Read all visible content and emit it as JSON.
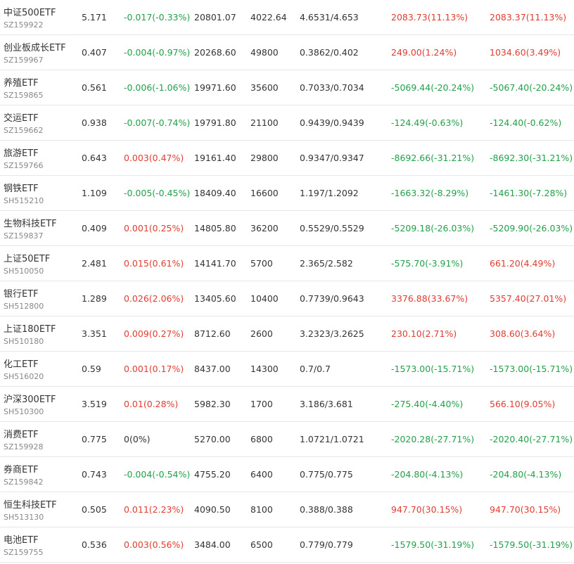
{
  "colors": {
    "up": "#e03c31",
    "down": "#21a04a",
    "flat": "#333333"
  },
  "rows": [
    {
      "name": "中证500ETF",
      "code": "SZ159922",
      "price": "5.171",
      "change": "-0.017(-0.33%)",
      "change_dir": "down",
      "amount": "20801.07",
      "volume": "4022.64",
      "range": "4.6531/4.653",
      "p1": "2083.73(11.13%)",
      "p1_dir": "up",
      "p2": "2083.37(11.13%)",
      "p2_dir": "up"
    },
    {
      "name": "创业板成长ETF",
      "code": "SZ159967",
      "price": "0.407",
      "change": "-0.004(-0.97%)",
      "change_dir": "down",
      "amount": "20268.60",
      "volume": "49800",
      "range": "0.3862/0.402",
      "p1": "249.00(1.24%)",
      "p1_dir": "up",
      "p2": "1034.60(3.49%)",
      "p2_dir": "up"
    },
    {
      "name": "养殖ETF",
      "code": "SZ159865",
      "price": "0.561",
      "change": "-0.006(-1.06%)",
      "change_dir": "down",
      "amount": "19971.60",
      "volume": "35600",
      "range": "0.7033/0.7034",
      "p1": "-5069.44(-20.24%)",
      "p1_dir": "down",
      "p2": "-5067.40(-20.24%)",
      "p2_dir": "down"
    },
    {
      "name": "交运ETF",
      "code": "SZ159662",
      "price": "0.938",
      "change": "-0.007(-0.74%)",
      "change_dir": "down",
      "amount": "19791.80",
      "volume": "21100",
      "range": "0.9439/0.9439",
      "p1": "-124.49(-0.63%)",
      "p1_dir": "down",
      "p2": "-124.40(-0.62%)",
      "p2_dir": "down"
    },
    {
      "name": "旅游ETF",
      "code": "SZ159766",
      "price": "0.643",
      "change": "0.003(0.47%)",
      "change_dir": "up",
      "amount": "19161.40",
      "volume": "29800",
      "range": "0.9347/0.9347",
      "p1": "-8692.66(-31.21%)",
      "p1_dir": "down",
      "p2": "-8692.30(-31.21%)",
      "p2_dir": "down"
    },
    {
      "name": "钢铁ETF",
      "code": "SH515210",
      "price": "1.109",
      "change": "-0.005(-0.45%)",
      "change_dir": "down",
      "amount": "18409.40",
      "volume": "16600",
      "range": "1.197/1.2092",
      "p1": "-1663.32(-8.29%)",
      "p1_dir": "down",
      "p2": "-1461.30(-7.28%)",
      "p2_dir": "down"
    },
    {
      "name": "生物科技ETF",
      "code": "SZ159837",
      "price": "0.409",
      "change": "0.001(0.25%)",
      "change_dir": "up",
      "amount": "14805.80",
      "volume": "36200",
      "range": "0.5529/0.5529",
      "p1": "-5209.18(-26.03%)",
      "p1_dir": "down",
      "p2": "-5209.90(-26.03%)",
      "p2_dir": "down"
    },
    {
      "name": "上证50ETF",
      "code": "SH510050",
      "price": "2.481",
      "change": "0.015(0.61%)",
      "change_dir": "up",
      "amount": "14141.70",
      "volume": "5700",
      "range": "2.365/2.582",
      "p1": "-575.70(-3.91%)",
      "p1_dir": "down",
      "p2": "661.20(4.49%)",
      "p2_dir": "up"
    },
    {
      "name": "银行ETF",
      "code": "SH512800",
      "price": "1.289",
      "change": "0.026(2.06%)",
      "change_dir": "up",
      "amount": "13405.60",
      "volume": "10400",
      "range": "0.7739/0.9643",
      "p1": "3376.88(33.67%)",
      "p1_dir": "up",
      "p2": "5357.40(27.01%)",
      "p2_dir": "up"
    },
    {
      "name": "上证180ETF",
      "code": "SH510180",
      "price": "3.351",
      "change": "0.009(0.27%)",
      "change_dir": "up",
      "amount": "8712.60",
      "volume": "2600",
      "range": "3.2323/3.2625",
      "p1": "230.10(2.71%)",
      "p1_dir": "up",
      "p2": "308.60(3.64%)",
      "p2_dir": "up"
    },
    {
      "name": "化工ETF",
      "code": "SH516020",
      "price": "0.59",
      "change": "0.001(0.17%)",
      "change_dir": "up",
      "amount": "8437.00",
      "volume": "14300",
      "range": "0.7/0.7",
      "p1": "-1573.00(-15.71%)",
      "p1_dir": "down",
      "p2": "-1573.00(-15.71%)",
      "p2_dir": "down"
    },
    {
      "name": "沪深300ETF",
      "code": "SH510300",
      "price": "3.519",
      "change": "0.01(0.28%)",
      "change_dir": "up",
      "amount": "5982.30",
      "volume": "1700",
      "range": "3.186/3.681",
      "p1": "-275.40(-4.40%)",
      "p1_dir": "down",
      "p2": "566.10(9.05%)",
      "p2_dir": "up"
    },
    {
      "name": "消费ETF",
      "code": "SZ159928",
      "price": "0.775",
      "change": "0(0%)",
      "change_dir": "flat",
      "amount": "5270.00",
      "volume": "6800",
      "range": "1.0721/1.0721",
      "p1": "-2020.28(-27.71%)",
      "p1_dir": "down",
      "p2": "-2020.40(-27.71%)",
      "p2_dir": "down"
    },
    {
      "name": "券商ETF",
      "code": "SZ159842",
      "price": "0.743",
      "change": "-0.004(-0.54%)",
      "change_dir": "down",
      "amount": "4755.20",
      "volume": "6400",
      "range": "0.775/0.775",
      "p1": "-204.80(-4.13%)",
      "p1_dir": "down",
      "p2": "-204.80(-4.13%)",
      "p2_dir": "down"
    },
    {
      "name": "恒生科技ETF",
      "code": "SH513130",
      "price": "0.505",
      "change": "0.011(2.23%)",
      "change_dir": "up",
      "amount": "4090.50",
      "volume": "8100",
      "range": "0.388/0.388",
      "p1": "947.70(30.15%)",
      "p1_dir": "up",
      "p2": "947.70(30.15%)",
      "p2_dir": "up"
    },
    {
      "name": "电池ETF",
      "code": "SZ159755",
      "price": "0.536",
      "change": "0.003(0.56%)",
      "change_dir": "up",
      "amount": "3484.00",
      "volume": "6500",
      "range": "0.779/0.779",
      "p1": "-1579.50(-31.19%)",
      "p1_dir": "down",
      "p2": "-1579.50(-31.19%)",
      "p2_dir": "down"
    }
  ]
}
